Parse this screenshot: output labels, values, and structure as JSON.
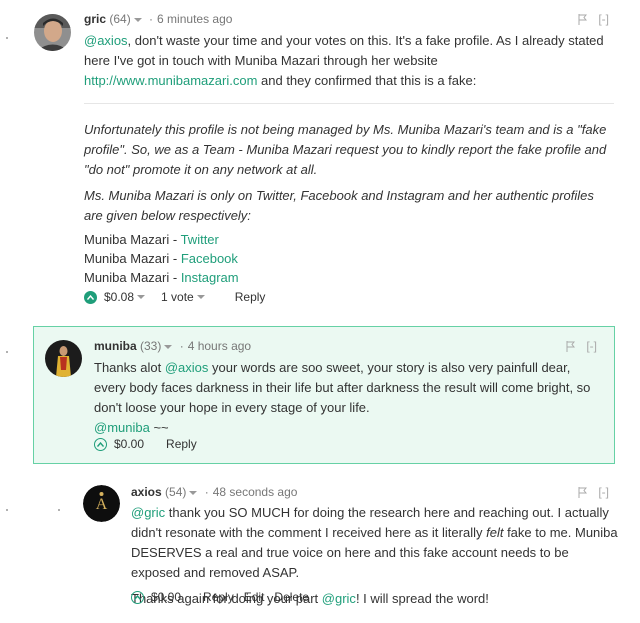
{
  "comments": [
    {
      "author": "gric",
      "reputation": "(64)",
      "time": "6 minutes ago",
      "collapse": "[-]",
      "intro_mention": "@axios",
      "intro_text_1": ", don't waste your time and your votes on this. It's a fake profile. As I already stated here I've got in touch with Muniba Mazari through her website ",
      "intro_link": "http://www.munibamazari.com",
      "intro_text_2": " and they confirmed that this is a fake:",
      "quote_1": "Unfortunately this profile is not being managed by Ms. Muniba Mazari's team and is a \"fake profile\". So, we as a Team - Muniba Mazari request you to kindly report the fake profile and \"do not\" promote it on any network at all.",
      "quote_2": "Ms. Muniba Mazari is only on Twitter, Facebook and Instagram and her authentic profiles are given below respectively:",
      "profiles": [
        {
          "name": "Muniba Mazari - ",
          "link": "Twitter"
        },
        {
          "name": "Muniba Mazari - ",
          "link": "Facebook"
        },
        {
          "name": "Muniba Mazari - ",
          "link": "Instagram"
        }
      ],
      "payout": "$0.08",
      "votes": "1 vote",
      "reply": "Reply"
    },
    {
      "author": "muniba",
      "reputation": "(33)",
      "time": "4 hours ago",
      "collapse": "[-]",
      "text_1": "Thanks alot ",
      "mention": "@axios",
      "text_2": " your words are soo sweet, your story is also very painfull dear, every body faces darkness in their life but after darkness the result will come bright, so don't loose your hope in every stage of your life.",
      "signature_mention": "@muniba",
      "signature_suffix": " ~~",
      "payout": "$0.00",
      "reply": "Reply"
    },
    {
      "author": "axios",
      "reputation": "(54)",
      "time": "48 seconds ago",
      "collapse": "[-]",
      "mention": "@gric",
      "text_1": " thank you SO MUCH for doing the research here and reaching out. I actually didn't resonate with the comment I received here as it literally ",
      "emphasis": "felt",
      "text_2": " fake to me. Muniba DESERVES a real and true voice on here and this fake account needs to be exposed and removed ASAP.",
      "p2_text_1": "Thanks again for doing your part ",
      "p2_mention": "@gric",
      "p2_text_2": "! I will spread the word!",
      "payout": "$0.00",
      "reply": "Reply",
      "edit": "Edit",
      "delete": "Delete"
    }
  ],
  "colors": {
    "link": "#1f9e7a",
    "highlight_bg": "#ebf9f2",
    "highlight_border": "#66d1a5"
  }
}
